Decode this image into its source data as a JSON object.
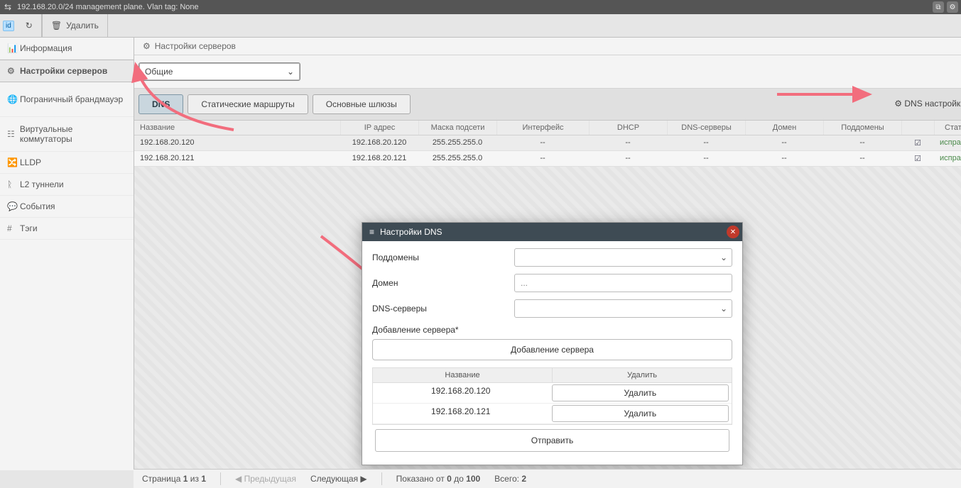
{
  "window": {
    "title": "192.168.20.0/24 management plane. Vlan tag: None"
  },
  "toolbar_top": {
    "id_tag": "id",
    "delete_label": "Удалить"
  },
  "sidebar": {
    "items": [
      {
        "icon": "stats",
        "label": "Информация"
      },
      {
        "icon": "gear",
        "label": "Настройки серверов",
        "selected": true
      },
      {
        "icon": "globe",
        "label": "Пограничный брандмауэр"
      },
      {
        "icon": "grid",
        "label": "Виртуальные коммутаторы"
      },
      {
        "icon": "share",
        "label": "LLDP"
      },
      {
        "icon": "plink",
        "label": "L2 туннели"
      },
      {
        "icon": "speech",
        "label": "События"
      },
      {
        "icon": "hash",
        "label": "Тэги"
      }
    ]
  },
  "breadcrumb": {
    "icon": "gear",
    "label": "Настройки серверов"
  },
  "scope_select": {
    "value": "Общие"
  },
  "tabs": [
    {
      "label": "DNS",
      "active": true
    },
    {
      "label": "Статические маршруты"
    },
    {
      "label": "Основные шлюзы"
    }
  ],
  "dns_settings_btn": "DNS настройки",
  "grid": {
    "columns": [
      "Название",
      "IP адрес",
      "Маска подсети",
      "Интерфейс",
      "DHCP",
      "DNS-серверы",
      "Домен",
      "Поддомены",
      "",
      "Статус"
    ],
    "rows": [
      {
        "name": "192.168.20.120",
        "ip": "192.168.20.120",
        "mask": "255.255.255.0",
        "iface": "--",
        "dhcp": "--",
        "dns": "--",
        "dom": "--",
        "sub": "--",
        "check": "☑",
        "status": "исправно"
      },
      {
        "name": "192.168.20.121",
        "ip": "192.168.20.121",
        "mask": "255.255.255.0",
        "iface": "--",
        "dhcp": "--",
        "dns": "--",
        "dom": "--",
        "sub": "--",
        "check": "☑",
        "status": "исправно"
      }
    ]
  },
  "modal": {
    "title": "Настройки DNS",
    "fields": {
      "subdomains": {
        "label": "Поддомены"
      },
      "domain": {
        "label": "Домен",
        "placeholder": "..."
      },
      "dns_servers": {
        "label": "DNS-серверы"
      },
      "add_server": {
        "label": "Добавление сервера*"
      }
    },
    "add_button": "Добавление сервера",
    "table": {
      "columns": [
        "Название",
        "Удалить"
      ],
      "rows": [
        {
          "name": "192.168.20.120",
          "del": "Удалить"
        },
        {
          "name": "192.168.20.121",
          "del": "Удалить"
        }
      ]
    },
    "send": "Отправить"
  },
  "footer": {
    "page_label": "Страница",
    "page_cur": "1",
    "page_of": "из",
    "page_total": "1",
    "prev": "Предыдущая",
    "next": "Следующая",
    "range_pre": "Показано от",
    "range_a": "0",
    "range_mid": "до",
    "range_b": "100",
    "total_label": "Всего:",
    "total": "2"
  },
  "icons": {
    "gear": "⚙",
    "stats": "📊",
    "globe": "🌐",
    "grid": "☷",
    "share": "🔀",
    "plink": "ᚱ",
    "speech": "💬",
    "hash": "#",
    "trash": "🗑",
    "refresh": "↻",
    "sliders": "≡",
    "chev": "⌄",
    "check": "☑",
    "copy": "⧉",
    "wingear": "⚙",
    "nw": "⇲"
  }
}
